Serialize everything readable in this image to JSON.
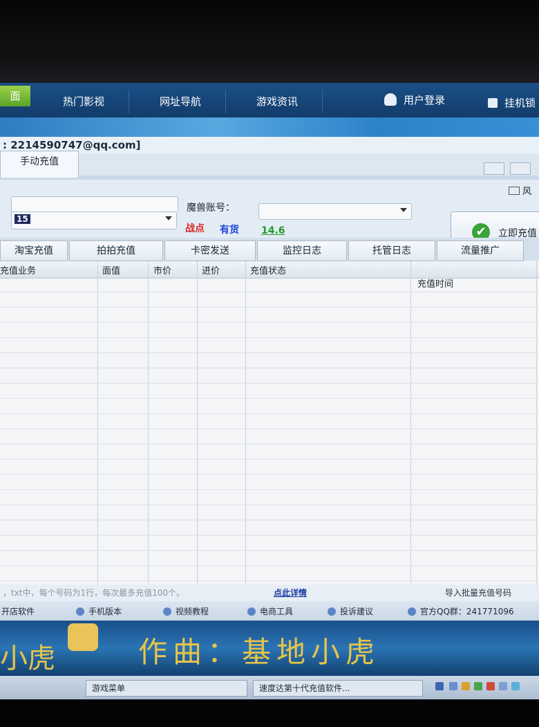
{
  "nav": {
    "active_tab": "面",
    "tabs": [
      "热门影视",
      "网址导航",
      "游戏资讯"
    ],
    "user_login": "用户登录",
    "lock_label": "挂机锁"
  },
  "account_line": ": 2214590747@qq.com]",
  "window": {
    "tab_manual": "手动充值",
    "wind_label": "风"
  },
  "form": {
    "account_value": "15",
    "warcraft_account_label": "魔兽账号：",
    "zhandian_label": "战点",
    "stock_label": "有货",
    "price_value": "14.6",
    "recharge_button": "立即充值"
  },
  "subtabs": [
    "淘宝充值",
    "拍拍充值",
    "卡密发送",
    "监控日志",
    "托管日志",
    "流量推广"
  ],
  "table": {
    "columns": [
      "充值业务",
      "面值",
      "市价",
      "进价",
      "充值状态",
      "充值时间"
    ],
    "rows": []
  },
  "hint": {
    "text": "，txt中，每个号码为1行，每次最多充值100个。",
    "link": "点此详情",
    "import_button": "导入批量充值号码"
  },
  "links": [
    "开店软件",
    "手机版本",
    "视频教程",
    "电商工具",
    "投诉建议",
    "官方QQ群：241771096"
  ],
  "media": {
    "left_text": "小虎",
    "main_text": "作曲：基地小虎"
  },
  "taskbar": {
    "item1": "游戏菜单",
    "item2": "速度达第十代充值软件..."
  }
}
